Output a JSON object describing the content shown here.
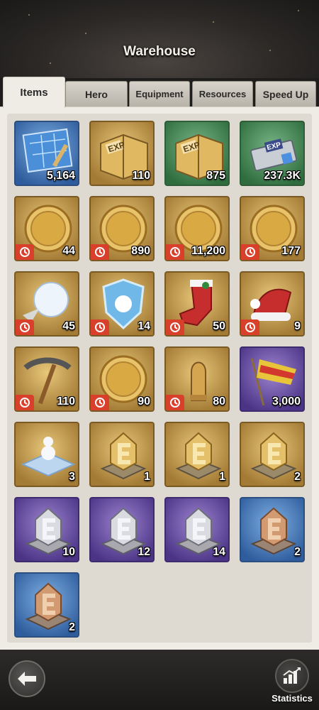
{
  "header": {
    "title": "Warehouse"
  },
  "tabs": [
    {
      "label": "Items",
      "active": true
    },
    {
      "label": "Hero",
      "active": false
    },
    {
      "label": "Equipment",
      "active": false
    },
    {
      "label": "Resources",
      "active": false
    },
    {
      "label": "Speed Up",
      "active": false
    }
  ],
  "items": [
    {
      "icon": "blueprint-map-icon",
      "rarity": "blue",
      "quantity": "5,164",
      "timed": false
    },
    {
      "icon": "exp-book-icon",
      "rarity": "gold",
      "quantity": "110",
      "timed": false
    },
    {
      "icon": "exp-book-icon",
      "rarity": "green",
      "quantity": "875",
      "timed": false
    },
    {
      "icon": "exp-chip-icon",
      "rarity": "green",
      "quantity": "237.3K",
      "timed": false
    },
    {
      "icon": "turkey-coin-icon",
      "rarity": "gold",
      "quantity": "44",
      "timed": true
    },
    {
      "icon": "ice-skate-coin-icon",
      "rarity": "gold",
      "quantity": "890",
      "timed": true
    },
    {
      "icon": "eagle-coin-icon",
      "rarity": "gold",
      "quantity": "11,200",
      "timed": true
    },
    {
      "icon": "pine-tree-coin-icon",
      "rarity": "gold",
      "quantity": "177",
      "timed": true
    },
    {
      "icon": "snowball-icon",
      "rarity": "gold",
      "quantity": "45",
      "timed": true
    },
    {
      "icon": "snow-shield-icon",
      "rarity": "gold",
      "quantity": "14",
      "timed": true
    },
    {
      "icon": "christmas-stocking-icon",
      "rarity": "gold",
      "quantity": "50",
      "timed": true
    },
    {
      "icon": "santa-hat-icon",
      "rarity": "gold",
      "quantity": "9",
      "timed": true
    },
    {
      "icon": "pickaxe-icon",
      "rarity": "gold",
      "quantity": "110",
      "timed": true
    },
    {
      "icon": "easter-egg-coin-icon",
      "rarity": "gold",
      "quantity": "90",
      "timed": true
    },
    {
      "icon": "bullet-icon",
      "rarity": "gold",
      "quantity": "80",
      "timed": true
    },
    {
      "icon": "flag-icon",
      "rarity": "purple",
      "quantity": "3,000",
      "timed": false
    },
    {
      "icon": "snowman-platform-icon",
      "rarity": "gold",
      "quantity": "3",
      "timed": false
    },
    {
      "icon": "emblem-e-gold-icon",
      "rarity": "gold",
      "quantity": "1",
      "timed": false
    },
    {
      "icon": "emblem-wing-gold-icon",
      "rarity": "gold",
      "quantity": "1",
      "timed": false
    },
    {
      "icon": "emblem-triangle-gold-icon",
      "rarity": "gold",
      "quantity": "2",
      "timed": false
    },
    {
      "icon": "emblem-e-silver-icon",
      "rarity": "purple",
      "quantity": "10",
      "timed": false
    },
    {
      "icon": "emblem-wing-silver-icon",
      "rarity": "purple",
      "quantity": "12",
      "timed": false
    },
    {
      "icon": "emblem-triangle-silver-icon",
      "rarity": "purple",
      "quantity": "14",
      "timed": false
    },
    {
      "icon": "emblem-e-bronze-icon",
      "rarity": "blue",
      "quantity": "2",
      "timed": false
    },
    {
      "icon": "emblem-triangle-bronze-icon",
      "rarity": "blue",
      "quantity": "2",
      "timed": false
    }
  ],
  "footer": {
    "back_icon": "back-arrow-icon",
    "stats_icon": "bar-chart-icon",
    "stats_label": "Statistics"
  },
  "colors": {
    "timer_badge": "#d8402b",
    "gold_frame": "#a47b35",
    "blue_frame": "#2e5c9d",
    "green_frame": "#2f6d3e",
    "purple_frame": "#4b3386"
  }
}
